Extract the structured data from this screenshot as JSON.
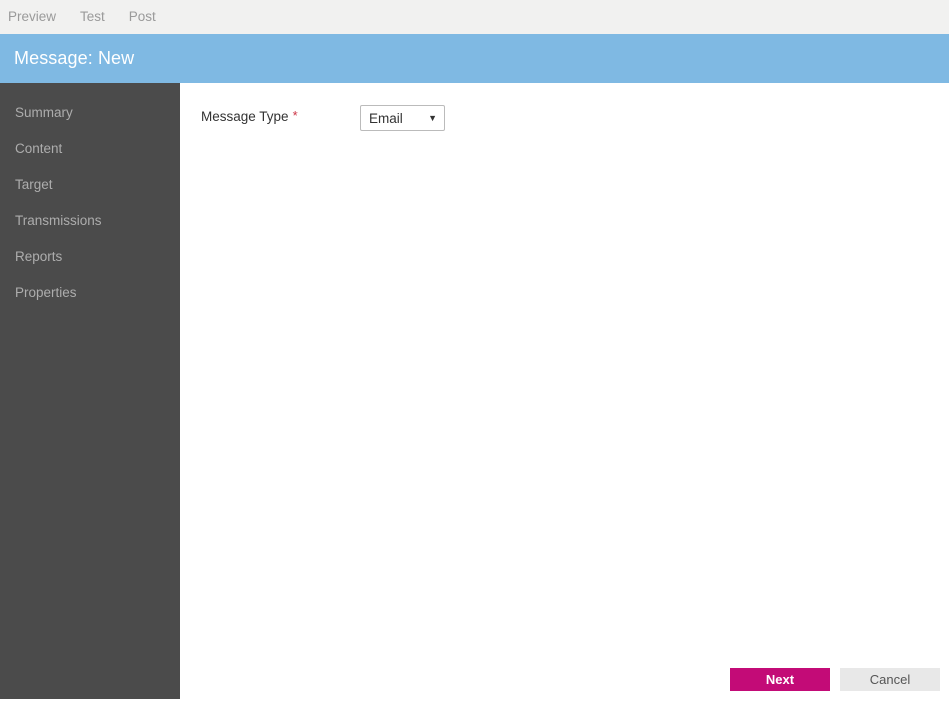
{
  "toolbar": {
    "actions": [
      {
        "label": "Preview",
        "name": "toolbar-preview"
      },
      {
        "label": "Test",
        "name": "toolbar-test"
      },
      {
        "label": "Post",
        "name": "toolbar-post"
      }
    ]
  },
  "header": {
    "title": "Message: New",
    "background": "#7fb9e3",
    "text_color": "#ffffff"
  },
  "sidebar": {
    "background": "#4b4b4b",
    "text_color": "#adadad",
    "items": [
      {
        "label": "Summary"
      },
      {
        "label": "Content"
      },
      {
        "label": "Target"
      },
      {
        "label": "Transmissions"
      },
      {
        "label": "Reports"
      },
      {
        "label": "Properties"
      }
    ]
  },
  "form": {
    "fields": [
      {
        "label": "Message Type",
        "required_marker": "*",
        "value": "Email",
        "options": [
          "Email"
        ]
      }
    ]
  },
  "footer": {
    "next_label": "Next",
    "cancel_label": "Cancel",
    "primary_color": "#c30b77",
    "secondary_color": "#e8e8e8"
  }
}
